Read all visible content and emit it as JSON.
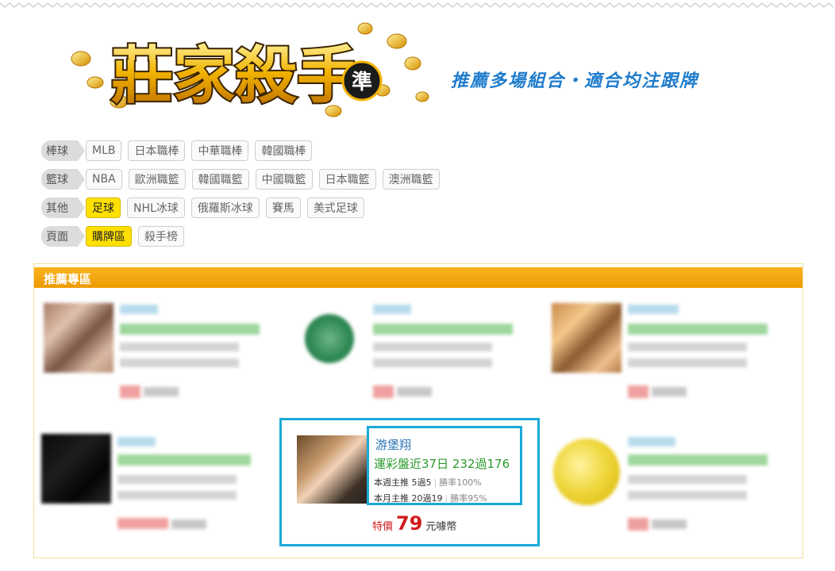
{
  "header": {
    "logo_text": "莊家殺手",
    "logo_badge": "準",
    "slogan": "推薦多場組合・適合均注跟牌"
  },
  "filters": [
    {
      "label": "棒球",
      "tags": [
        {
          "text": "MLB",
          "active": false
        },
        {
          "text": "日本職棒",
          "active": false
        },
        {
          "text": "中華職棒",
          "active": false
        },
        {
          "text": "韓國職棒",
          "active": false
        }
      ]
    },
    {
      "label": "籃球",
      "tags": [
        {
          "text": "NBA",
          "active": false
        },
        {
          "text": "歐洲職籃",
          "active": false
        },
        {
          "text": "韓國職籃",
          "active": false
        },
        {
          "text": "中國職籃",
          "active": false
        },
        {
          "text": "日本職籃",
          "active": false
        },
        {
          "text": "澳洲職籃",
          "active": false
        }
      ]
    },
    {
      "label": "其他",
      "tags": [
        {
          "text": "足球",
          "active": true
        },
        {
          "text": "NHL冰球",
          "active": false
        },
        {
          "text": "俄羅斯冰球",
          "active": false
        },
        {
          "text": "賽馬",
          "active": false
        },
        {
          "text": "美式足球",
          "active": false
        }
      ]
    },
    {
      "label": "頁面",
      "tags": [
        {
          "text": "購牌區",
          "active": true
        },
        {
          "text": "殺手榜",
          "active": false
        }
      ]
    }
  ],
  "recommend": {
    "title": "推薦專區",
    "featured": {
      "name": "游堡翔",
      "record": "運彩盤近37日 232過176",
      "week_label": "本週主推 5過5",
      "week_rate": "勝率100%",
      "month_label": "本月主推 20過19",
      "month_rate": "勝率95%",
      "price_label": "特價",
      "price_value": "79",
      "price_unit": "元噱幣"
    }
  },
  "colors": {
    "accent_orange": "#f4a400",
    "highlight_yellow": "#ffe000",
    "featured_border": "#1ba9d9",
    "record_green": "#2b9a2b",
    "price_red": "#d01c1c",
    "name_blue": "#2b74b5"
  }
}
